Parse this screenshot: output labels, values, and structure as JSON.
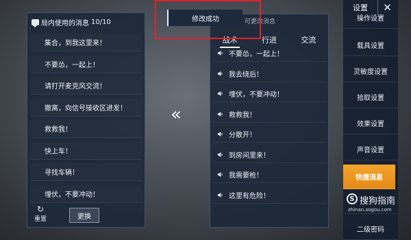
{
  "left_panel": {
    "title": "局内使用的消息",
    "count": "10/10",
    "items": [
      "集合，到我这里来！",
      "不要怂，一起上！",
      "请打开麦克风交流！",
      "撤离，向信号接收区进发！",
      "救救我！",
      "快上车！",
      "寻找车辆！",
      "埋伏，不要冲动！"
    ],
    "reset_label": "重置",
    "swap_label": "更换"
  },
  "transfer_arrow": "«",
  "toast": {
    "text": "修改成功"
  },
  "right_panel": {
    "hint": "可更改消息",
    "tabs": [
      {
        "label": "战术",
        "active": true
      },
      {
        "label": "行进",
        "active": false
      },
      {
        "label": "交流",
        "active": false
      }
    ],
    "items": [
      "不要怂，一起上！",
      "我去绕后！",
      "埋伏，不要冲动！",
      "救救我！",
      "分散开！",
      "到房间里来！",
      "我需要枪！",
      "这里有危险！"
    ]
  },
  "settings": {
    "title": "设置",
    "close_icon": "close-icon",
    "items": [
      {
        "label": "操作设置",
        "active": false
      },
      {
        "label": "载具设置",
        "active": false
      },
      {
        "label": "灵敏度设置",
        "active": false
      },
      {
        "label": "拾取设置",
        "active": false
      },
      {
        "label": "效果设置",
        "active": false
      },
      {
        "label": "声音设置",
        "active": false
      },
      {
        "label": "快捷消息",
        "active": true
      },
      {
        "label": "",
        "active": false
      },
      {
        "label": "二级密码",
        "active": false
      }
    ]
  },
  "watermark": {
    "text": "搜狗指南",
    "url": "zhinan.sogou.com"
  },
  "colors": {
    "accent": "#f29a25",
    "highlight_box": "#e4202a",
    "panel": "#1c283a"
  }
}
